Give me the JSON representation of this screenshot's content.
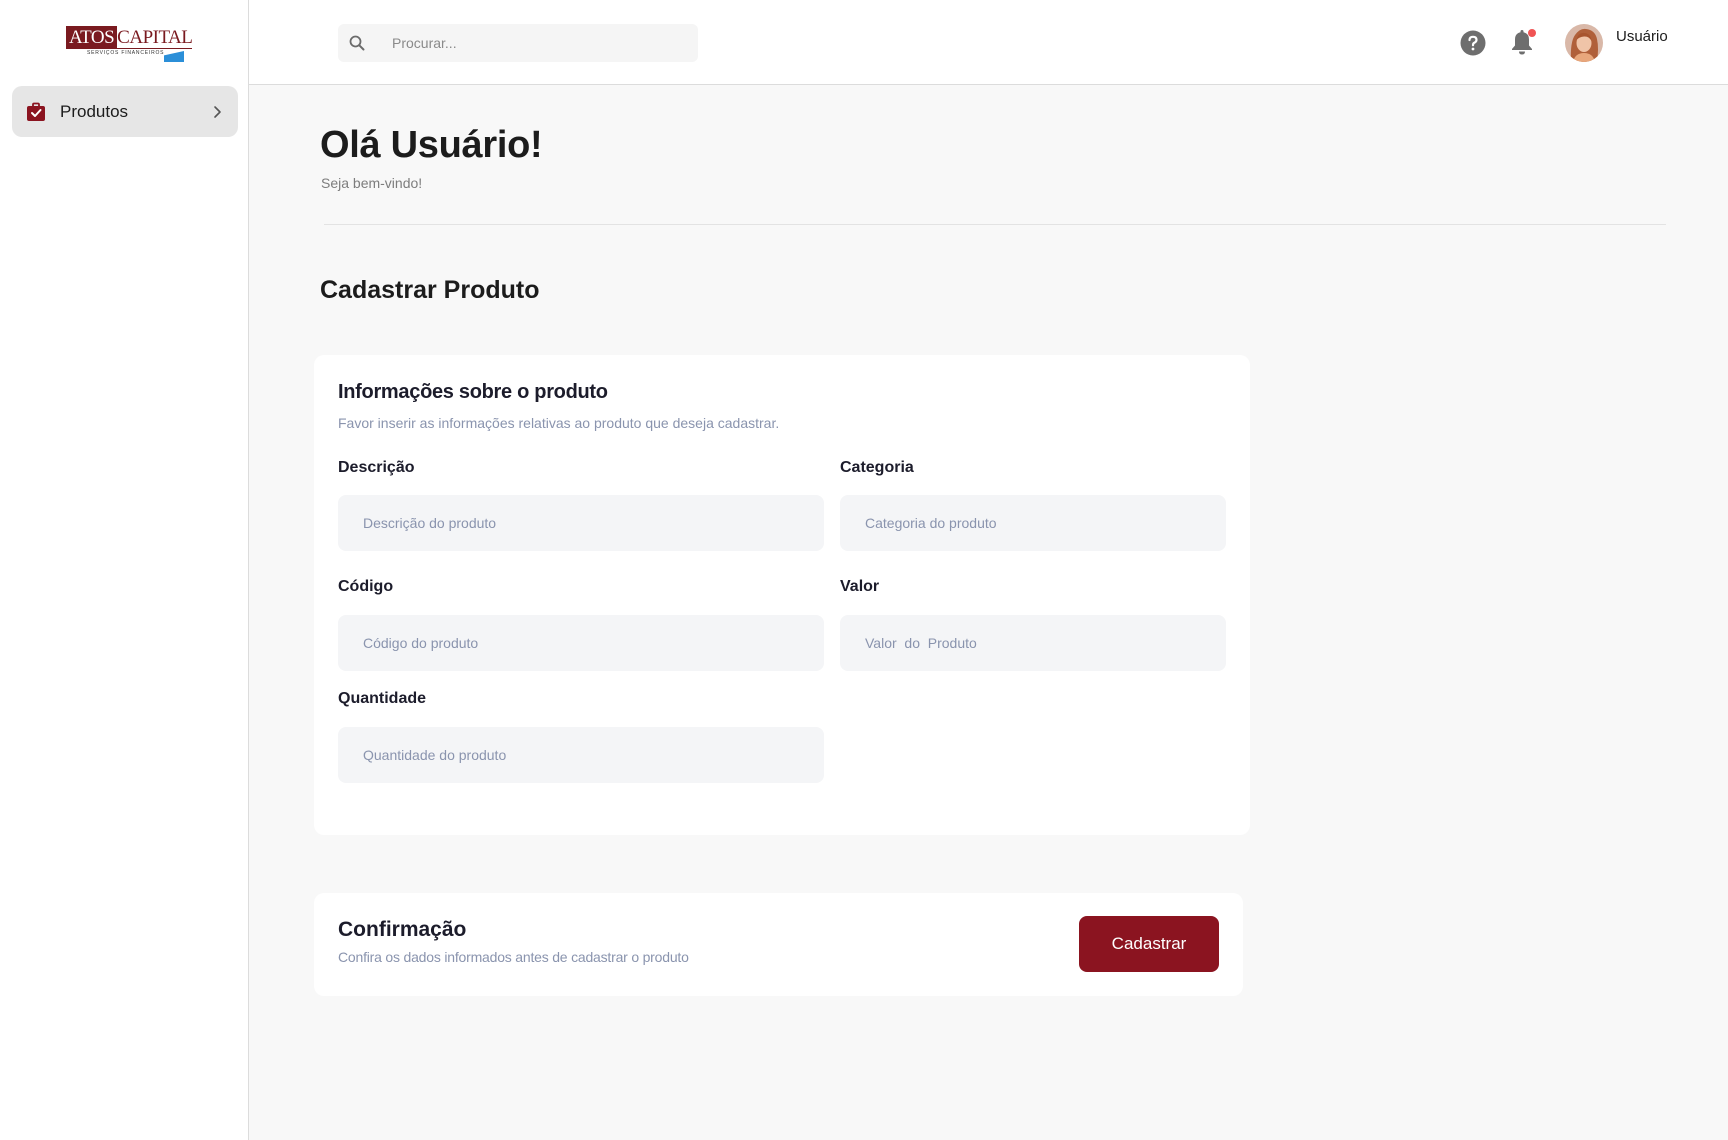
{
  "brand": {
    "logo_word_1": "ATOS",
    "logo_word_2": "CAPITAL",
    "logo_tagline": "SERVIÇOS FINANCEIROS",
    "color": "#7a1a20"
  },
  "sidebar": {
    "items": [
      {
        "label": "Produtos",
        "icon": "shopping-bag-check-icon",
        "active": true
      }
    ]
  },
  "header": {
    "search": {
      "placeholder": "Procurar...",
      "value": ""
    },
    "help_icon": "help-circle-icon",
    "notification_icon": "bell-icon",
    "notification_dot_color": "#f05454",
    "user_name": "Usuário"
  },
  "main": {
    "greeting": "Olá Usuário!",
    "welcome": "Seja bem-vindo!",
    "section_title": "Cadastrar Produto",
    "form": {
      "title": "Informações sobre o produto",
      "subtitle": "Favor inserir as informações relativas ao produto que deseja cadastrar.",
      "fields": {
        "descricao": {
          "label": "Descrição",
          "placeholder": "Descrição do produto",
          "value": ""
        },
        "categoria": {
          "label": "Categoria",
          "placeholder": "Categoria do produto",
          "value": ""
        },
        "codigo": {
          "label": "Código",
          "placeholder": "Código do produto",
          "value": ""
        },
        "valor": {
          "label": "Valor",
          "placeholder": "Valor  do  Produto",
          "value": ""
        },
        "quantidade": {
          "label": "Quantidade",
          "placeholder": "Quantidade do produto",
          "value": ""
        }
      }
    },
    "confirmation": {
      "title": "Confirmação",
      "subtitle": "Confira os dados informados antes de cadastrar o produto",
      "button_label": "Cadastrar",
      "button_color": "#8b1420"
    }
  }
}
